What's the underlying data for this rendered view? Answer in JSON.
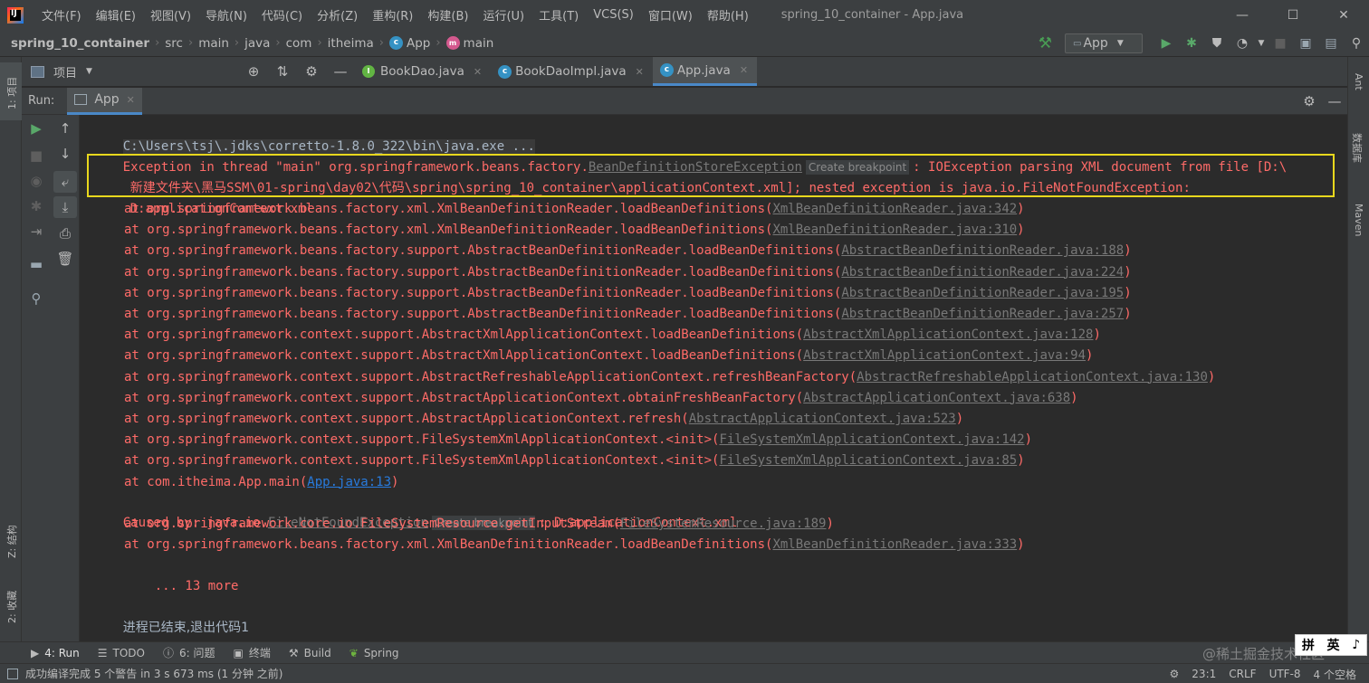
{
  "menubar": {
    "items": [
      "文件(F)",
      "编辑(E)",
      "视图(V)",
      "导航(N)",
      "代码(C)",
      "分析(Z)",
      "重构(R)",
      "构建(B)",
      "运行(U)",
      "工具(T)",
      "VCS(S)",
      "窗口(W)",
      "帮助(H)"
    ],
    "window_title": "spring_10_container - App.java"
  },
  "breadcrumb": [
    "spring_10_container",
    "src",
    "main",
    "java",
    "com",
    "itheima",
    "App",
    "main"
  ],
  "run_config": {
    "label": "App"
  },
  "project_panel": {
    "label": "项目"
  },
  "editor_tabs": [
    {
      "label": "BookDao.java",
      "icon": "interface-icon"
    },
    {
      "label": "BookDaoImpl.java",
      "icon": "class-icon"
    },
    {
      "label": "App.java",
      "icon": "class-icon",
      "active": true
    }
  ],
  "run_panel": {
    "title": "Run:",
    "tab": "App"
  },
  "console": {
    "java_cmd": "C:\\Users\\tsj\\.jdks\\corretto-1.8.0_322\\bin\\java.exe ...",
    "exc_prefix": "Exception in thread \"main\" org.springframework.beans.factory.",
    "exc_class": "BeanDefinitionStoreException",
    "create_breakpoint": "Create breakpoint",
    "exc_suffix": ": IOException parsing XML document from file [D:\\",
    "exc_line2": "新建文件夹\\黑马SSM\\01-spring\\day02\\代码\\spring\\spring_10_container\\applicationContext.xml]; nested exception is java.io.FileNotFoundException:",
    "exc_line3": "D:applicationContext.xml",
    "stack": [
      {
        "method": "at org.springframework.beans.factory.xml.XmlBeanDefinitionReader.loadBeanDefinitions(",
        "link": "XmlBeanDefinitionReader.java:342",
        "end": ")"
      },
      {
        "method": "at org.springframework.beans.factory.xml.XmlBeanDefinitionReader.loadBeanDefinitions(",
        "link": "XmlBeanDefinitionReader.java:310",
        "end": ")"
      },
      {
        "method": "at org.springframework.beans.factory.support.AbstractBeanDefinitionReader.loadBeanDefinitions(",
        "link": "AbstractBeanDefinitionReader.java:188",
        "end": ")"
      },
      {
        "method": "at org.springframework.beans.factory.support.AbstractBeanDefinitionReader.loadBeanDefinitions(",
        "link": "AbstractBeanDefinitionReader.java:224",
        "end": ")"
      },
      {
        "method": "at org.springframework.beans.factory.support.AbstractBeanDefinitionReader.loadBeanDefinitions(",
        "link": "AbstractBeanDefinitionReader.java:195",
        "end": ")"
      },
      {
        "method": "at org.springframework.beans.factory.support.AbstractBeanDefinitionReader.loadBeanDefinitions(",
        "link": "AbstractBeanDefinitionReader.java:257",
        "end": ")"
      },
      {
        "method": "at org.springframework.context.support.AbstractXmlApplicationContext.loadBeanDefinitions(",
        "link": "AbstractXmlApplicationContext.java:128",
        "end": ")"
      },
      {
        "method": "at org.springframework.context.support.AbstractXmlApplicationContext.loadBeanDefinitions(",
        "link": "AbstractXmlApplicationContext.java:94",
        "end": ")"
      },
      {
        "method": "at org.springframework.context.support.AbstractRefreshableApplicationContext.refreshBeanFactory(",
        "link": "AbstractRefreshableApplicationContext.java:130",
        "end": ")"
      },
      {
        "method": "at org.springframework.context.support.AbstractApplicationContext.obtainFreshBeanFactory(",
        "link": "AbstractApplicationContext.java:638",
        "end": ")"
      },
      {
        "method": "at org.springframework.context.support.AbstractApplicationContext.refresh(",
        "link": "AbstractApplicationContext.java:523",
        "end": ")"
      },
      {
        "method": "at org.springframework.context.support.FileSystemXmlApplicationContext.<init>(",
        "link": "FileSystemXmlApplicationContext.java:142",
        "end": ")"
      },
      {
        "method": "at org.springframework.context.support.FileSystemXmlApplicationContext.<init>(",
        "link": "FileSystemXmlApplicationContext.java:85",
        "end": ")"
      },
      {
        "method": "at com.itheima.App.main(",
        "link": "App.java:13",
        "end": ")",
        "own": true
      }
    ],
    "caused_prefix": "Caused by: java.io.",
    "caused_class": "FileNotFoundException",
    "caused_suffix": ": D:applicationContext.xml",
    "stack2": [
      {
        "method": "at org.springframework.core.io.FileSystemResource.getInputStream(",
        "link": "FileSystemResource.java:189",
        "end": ")"
      },
      {
        "method": "at org.springframework.beans.factory.xml.XmlBeanDefinitionReader.loadBeanDefinitions(",
        "link": "XmlBeanDefinitionReader.java:333",
        "end": ")"
      }
    ],
    "more": "... 13 more",
    "exit_msg": "进程已结束,退出代码1"
  },
  "left_stripe": {
    "top": "1: 项目",
    "mid": "Z: 结构",
    "bottom": "2: 收藏"
  },
  "right_stripe": {
    "ant": "Ant",
    "db": "数据库",
    "maven": "Maven"
  },
  "bottom_tabs": [
    {
      "label": "4: Run",
      "icon": "run-icon"
    },
    {
      "label": "TODO",
      "icon": "todo-icon"
    },
    {
      "label": "6: 问题",
      "icon": "problems-icon"
    },
    {
      "label": "终端",
      "icon": "terminal-icon"
    },
    {
      "label": "Build",
      "icon": "build-icon"
    },
    {
      "label": "Spring",
      "icon": "spring-icon"
    }
  ],
  "status": {
    "message": "成功编译完成 5 个警告 in 3 s 673 ms (1 分钟 之前)",
    "position": "23:1",
    "line_sep": "CRLF",
    "encoding": "UTF-8",
    "indent": "4 个空格"
  },
  "ime": {
    "a": "拼",
    "b": "英"
  },
  "watermark": "@稀土掘金技术社区",
  "colors": {
    "error": "#ff6b68",
    "highlight": "#e8d71d",
    "accent": "#4a88c7"
  }
}
